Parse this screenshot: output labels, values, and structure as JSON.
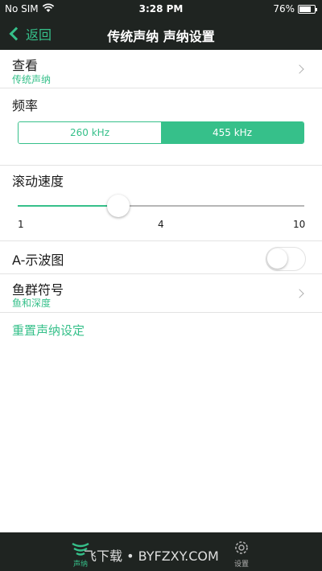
{
  "status_bar": {
    "carrier": "No SIM",
    "time": "3:28 PM",
    "battery": "76%",
    "battery_level": 0.76
  },
  "nav": {
    "back_label": "返回",
    "title": "传统声纳 声纳设置"
  },
  "view": {
    "title": "查看",
    "value": "传统声纳"
  },
  "frequency": {
    "title": "频率",
    "options": [
      "260 kHz",
      "455 kHz"
    ],
    "selected_index": 1
  },
  "scroll_speed": {
    "title": "滚动速度",
    "tick_labels": [
      "1",
      "4",
      "10"
    ],
    "value": 0.35
  },
  "a_scope": {
    "title": "A-示波图",
    "enabled": false
  },
  "fish_symbol": {
    "title": "鱼群符号",
    "value": "鱼和深度"
  },
  "reset_label": "重置声纳设定",
  "tabbar": {
    "tabs": [
      {
        "label": "声纳",
        "icon": "sonar-icon",
        "active": true
      },
      {
        "label": "设置",
        "icon": "gear-icon",
        "active": false
      }
    ]
  },
  "watermark": "飞下载 • BYFZXY.COM",
  "colors": {
    "accent": "#36c08a",
    "bar_background": "#1f2421"
  }
}
